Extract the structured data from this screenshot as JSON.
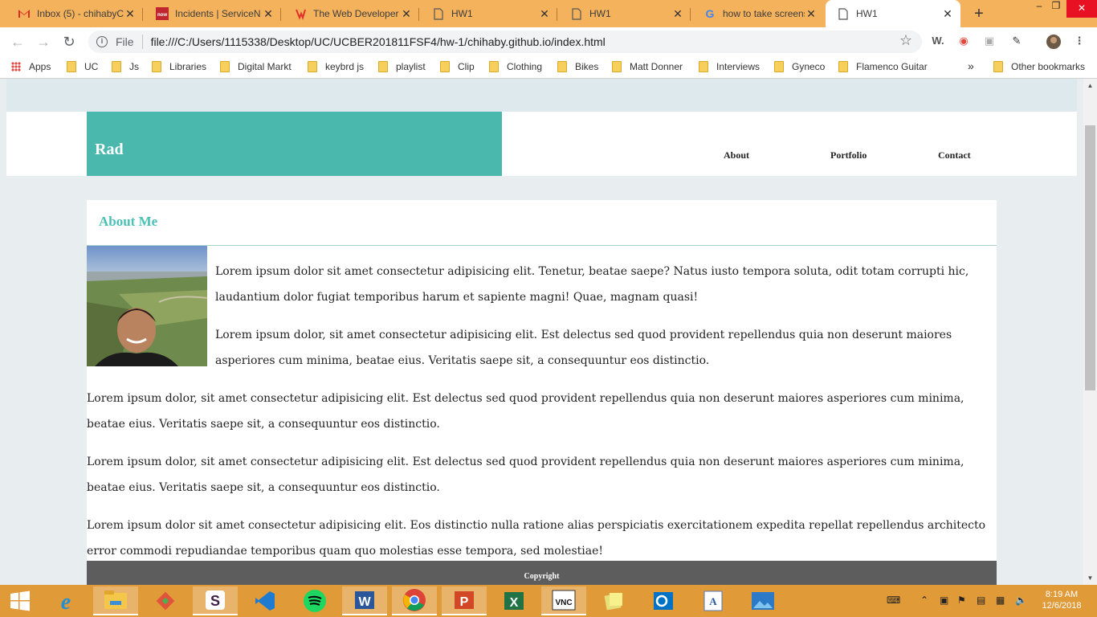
{
  "browser": {
    "tabs": [
      {
        "title": "Inbox (5) - chihabyC",
        "favicon": "gmail-icon"
      },
      {
        "title": "Incidents | ServiceN",
        "favicon": "servicenow-icon"
      },
      {
        "title": "The Web Developer",
        "favicon": "udemy-icon"
      },
      {
        "title": "HW1",
        "favicon": "document-icon"
      },
      {
        "title": "HW1",
        "favicon": "document-icon"
      },
      {
        "title": "how to take screens",
        "favicon": "google-icon"
      },
      {
        "title": "HW1",
        "favicon": "document-icon",
        "active": true
      }
    ],
    "address": {
      "scheme": "File",
      "url": "file:///C:/Users/1115338/Desktop/UC/UCBER201811FSF4/hw-1/chihaby.github.io/index.html"
    },
    "bookmarks": [
      {
        "label": "Apps",
        "icon": "apps-grid-icon"
      },
      {
        "label": "UC"
      },
      {
        "label": "Js"
      },
      {
        "label": "Libraries"
      },
      {
        "label": "Digital Markt"
      },
      {
        "label": "keybrd js"
      },
      {
        "label": "playlist"
      },
      {
        "label": "Clip"
      },
      {
        "label": "Clothing"
      },
      {
        "label": "Bikes"
      },
      {
        "label": "Matt Donner"
      },
      {
        "label": "Interviews"
      },
      {
        "label": "Gyneco"
      },
      {
        "label": "Flamenco Guitar"
      }
    ],
    "overflow": "»",
    "other_bookmarks": "Other bookmarks"
  },
  "page": {
    "brand": "Rad",
    "nav": [
      "About",
      "Portfolio",
      "Contact"
    ],
    "section_title": "About Me",
    "paragraphs": [
      "Lorem ipsum dolor sit amet consectetur adipisicing elit. Tenetur, beatae saepe? Natus iusto tempora soluta, odit totam corrupti hic, laudantium dolor fugiat temporibus harum et sapiente magni! Quae, magnam quasi!",
      "Lorem ipsum dolor, sit amet consectetur adipisicing elit. Est delectus sed quod provident repellendus quia non deserunt maiores asperiores cum minima, beatae eius. Veritatis saepe sit, a consequuntur eos distinctio.",
      "Lorem ipsum dolor, sit amet consectetur adipisicing elit. Est delectus sed quod provident repellendus quia non deserunt maiores asperiores cum minima, beatae eius. Veritatis saepe sit, a consequuntur eos distinctio.",
      "Lorem ipsum dolor, sit amet consectetur adipisicing elit. Est delectus sed quod provident repellendus quia non deserunt maiores asperiores cum minima, beatae eius. Veritatis saepe sit, a consequuntur eos distinctio.",
      "Lorem ipsum dolor sit amet consectetur adipisicing elit. Eos distinctio nulla ratione alias perspiciatis exercitationem expedita repellat repellendus architecto error commodi repudiandae temporibus quam quo molestias esse tempora, sed molestiae!"
    ],
    "footer": "Copyright"
  },
  "taskbar": {
    "apps": [
      "start-icon",
      "internet-explorer-icon",
      "file-explorer-icon",
      "git-icon",
      "slack-icon",
      "vscode-icon",
      "spotify-icon",
      "word-icon",
      "chrome-icon",
      "powerpoint-icon",
      "excel-icon",
      "vnc-icon",
      "sticky-notes-icon",
      "outlook-icon",
      "wordpad-icon",
      "photos-icon"
    ],
    "clock": {
      "time": "8:19 AM",
      "date": "12/6/2018"
    }
  },
  "colors": {
    "accent_teal": "#4bb8ae",
    "tab_strip": "#f5b25c",
    "taskbar": "#e09a38",
    "footer": "#5d5d5d"
  }
}
